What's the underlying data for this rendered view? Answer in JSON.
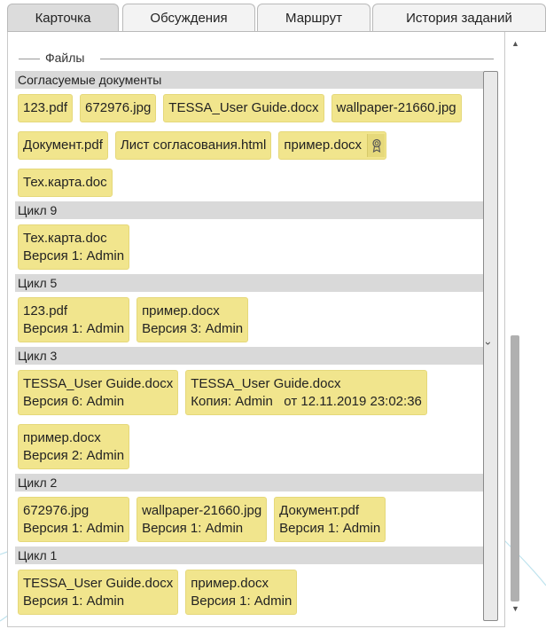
{
  "tabs": [
    {
      "label": "Карточка",
      "active": true
    },
    {
      "label": "Обсуждения",
      "active": false
    },
    {
      "label": "Маршрут",
      "active": false
    },
    {
      "label": "История заданий",
      "active": false
    }
  ],
  "files_section_label": "Файлы",
  "groups": [
    {
      "header": "Согласуемые документы",
      "files": [
        {
          "name": "123.pdf"
        },
        {
          "name": "672976.jpg"
        },
        {
          "name": "TESSA_User Guide.docx"
        },
        {
          "name": "wallpaper-21660.jpg"
        },
        {
          "name": "Документ.pdf"
        },
        {
          "name": "Лист согласования.html"
        },
        {
          "name": "пример.docx",
          "badge_icon": "certificate-icon"
        },
        {
          "name": "Тех.карта.doc"
        }
      ]
    },
    {
      "header": "Цикл 9",
      "files": [
        {
          "name": "Тех.карта.doc",
          "meta": "Версия 1: Admin"
        }
      ]
    },
    {
      "header": "Цикл 5",
      "files": [
        {
          "name": "123.pdf",
          "meta": "Версия 1: Admin"
        },
        {
          "name": "пример.docx",
          "meta": "Версия 3: Admin"
        }
      ]
    },
    {
      "header": "Цикл 3",
      "files": [
        {
          "name": "TESSA_User Guide.docx",
          "meta": "Версия 6: Admin"
        },
        {
          "name": "TESSA_User Guide.docx",
          "meta": "Копия: Admin   от 12.11.2019 23:02:36"
        },
        {
          "name": "пример.docx",
          "meta": "Версия 2: Admin"
        }
      ]
    },
    {
      "header": "Цикл 2",
      "files": [
        {
          "name": "672976.jpg",
          "meta": "Версия 1: Admin"
        },
        {
          "name": "wallpaper-21660.jpg",
          "meta": "Версия 1: Admin"
        },
        {
          "name": "Документ.pdf",
          "meta": "Версия 1: Admin"
        }
      ]
    },
    {
      "header": "Цикл 1",
      "files": [
        {
          "name": "TESSA_User Guide.docx",
          "meta": "Версия 1: Admin"
        },
        {
          "name": "пример.docx",
          "meta": "Версия 1: Admin"
        }
      ]
    }
  ],
  "colors": {
    "chip_fill": "#f1e58d",
    "group_header": "#d9d9d9",
    "active_tab": "#dcdcdc"
  },
  "icons": {
    "scroll_up": "▲",
    "scroll_down": "▼",
    "collapse_chevron": "›"
  }
}
